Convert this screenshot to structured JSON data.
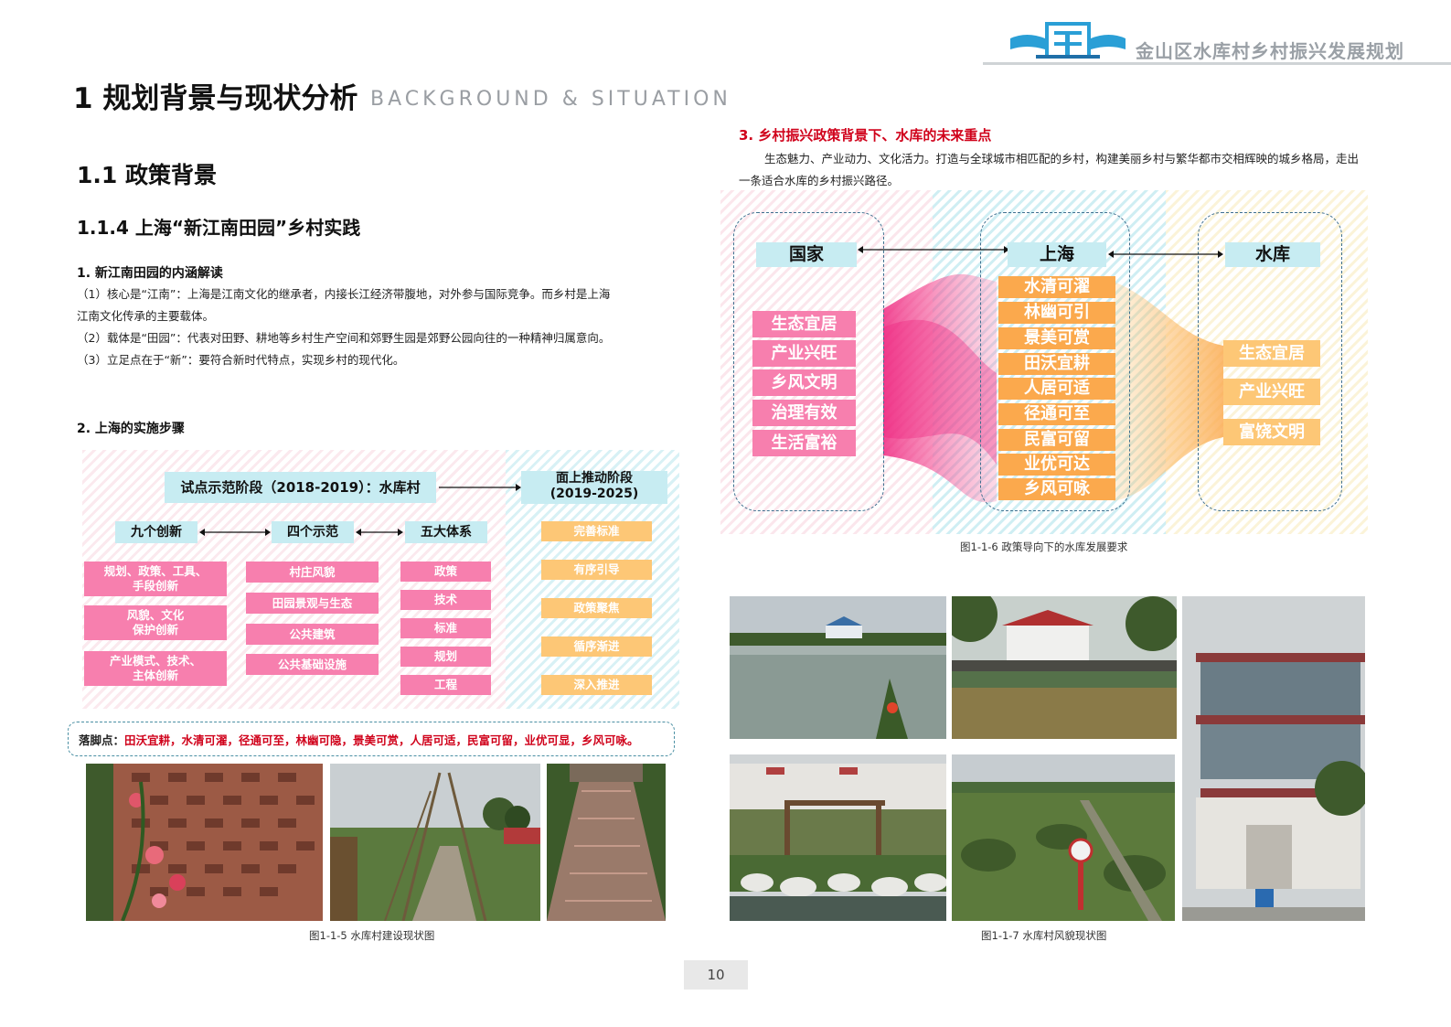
{
  "header": {
    "title": "金山区水库村乡村振兴发展规划",
    "logo_text": "库"
  },
  "page": {
    "title": "1 规划背景与现状分析",
    "subtitle": "BACKGROUND & SITUATION",
    "section": "1.1 政策背景",
    "subsection": "1.1.4 上海“新江南田园”乡村实践",
    "page_number": "10"
  },
  "part1": {
    "heading": "1. 新江南田园的内涵解读",
    "lines": [
      "（1）核心是“江南”：上海是江南文化的继承者，内接长江经济带腹地，对外参与国际竞争。而乡村是上海",
      "江南文化传承的主要载体。",
      "（2）载体是“田园”：代表对田野、耕地等乡村生产空间和郊野生园是郊野公园向往的一种精神归属意向。",
      "（3）立足点在于“新”：要符合新时代特点，实现乡村的现代化。"
    ]
  },
  "part2": {
    "heading": "2. 上海的实施步骤",
    "pilot": "试点示范阶段（2018-2019）：水库村",
    "rollout_line1": "面上推动阶段",
    "rollout_line2": "(2019-2025)",
    "col_heads": [
      "九个创新",
      "四个示范",
      "五大体系"
    ],
    "innovations": [
      [
        "规划、政策、工具、",
        "手段创新"
      ],
      [
        "风貌、文化",
        "保护创新"
      ],
      [
        "产业模式、技术、",
        "主体创新"
      ]
    ],
    "demos": [
      "村庄风貌",
      "田园景观与生态",
      "公共建筑",
      "公共基础设施"
    ],
    "systems": [
      "政策",
      "技术",
      "标准",
      "规划",
      "工程"
    ],
    "steps": [
      "完善标准",
      "有序引导",
      "政策聚焦",
      "循序渐进",
      "深入推进"
    ],
    "footnote_label": "落脚点：",
    "footnote_items": "田沃宜耕，水清可濯，径通可至，林幽可隐，景美可赏，人居可适，民富可留，业优可显，乡风可咏。"
  },
  "captions": {
    "fig5": "图1-1-5  水库村建设现状图",
    "fig6": "图1-1-6  政策导向下的水库发展要求",
    "fig7": "图1-1-7  水库村风貌现状图"
  },
  "part3": {
    "heading": "3. 乡村振兴政策背景下、水库的未来重点",
    "text": "生态魅力、产业动力、文化活力。打造与全球城市相匹配的乡村，构建美丽乡村与繁华都市交相辉映的城乡格局，走出一条适合水库的乡村振兴路径。",
    "country": "国家",
    "shanghai": "上海",
    "reservoir": "水库",
    "country_items": [
      "生态宜居",
      "产业兴旺",
      "乡风文明",
      "治理有效",
      "生活富裕"
    ],
    "shanghai_items": [
      "水清可濯",
      "林幽可引",
      "景美可赏",
      "田沃宜耕",
      "人居可适",
      "径通可至",
      "民富可留",
      "业优可达",
      "乡风可咏"
    ],
    "reservoir_items": [
      "生态宜居",
      "产业兴旺",
      "富饶文明"
    ],
    "colors": {
      "pink": "#f77fae",
      "magenta": "#ee1d7a",
      "orange": "#fba94d",
      "light_orange": "#fdc776",
      "cyan": "#c7ecf2"
    }
  }
}
